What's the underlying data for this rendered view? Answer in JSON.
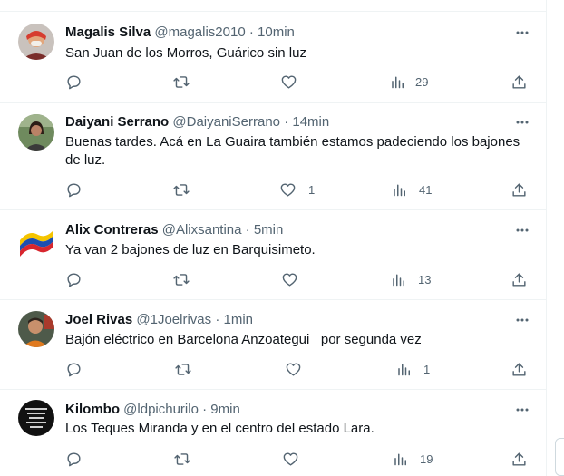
{
  "tweets": [
    {
      "name": "Magalis Silva",
      "handle": "@magalis2010",
      "time": "· 10min",
      "text": "San Juan de los Morros, Guárico sin luz",
      "likes": "",
      "views": "29"
    },
    {
      "name": "Daiyani Serrano",
      "handle": "@DaiyaniSerrano",
      "time": "· 14min",
      "text": "Buenas tardes. Acá en La Guaira también estamos padeciendo los bajones de luz.",
      "likes": "1",
      "views": "41"
    },
    {
      "name": "Alix Contreras",
      "handle": "@Alixsantina",
      "time": "· 5min",
      "text": "Ya van 2 bajones de luz en Barquisimeto.",
      "likes": "",
      "views": "13"
    },
    {
      "name": "Joel Rivas",
      "handle": "@1Joelrivas",
      "time": "· 1min",
      "text": "Bajón eléctrico en Barcelona Anzoategui   por segunda vez",
      "likes": "",
      "views": "1"
    },
    {
      "name": "Kilombo",
      "handle": "@ldpichurilo",
      "time": "· 9min",
      "text": "Los Teques Miranda y en el centro del estado Lara.",
      "likes": "",
      "views": "19"
    }
  ],
  "icons": {
    "reply": "reply-icon",
    "retweet": "retweet-icon",
    "like": "like-icon",
    "views": "views-icon",
    "share": "share-icon",
    "more": "more-icon"
  },
  "colors": {
    "text": "#0f1419",
    "secondary": "#536471",
    "border": "#eff3f4"
  }
}
